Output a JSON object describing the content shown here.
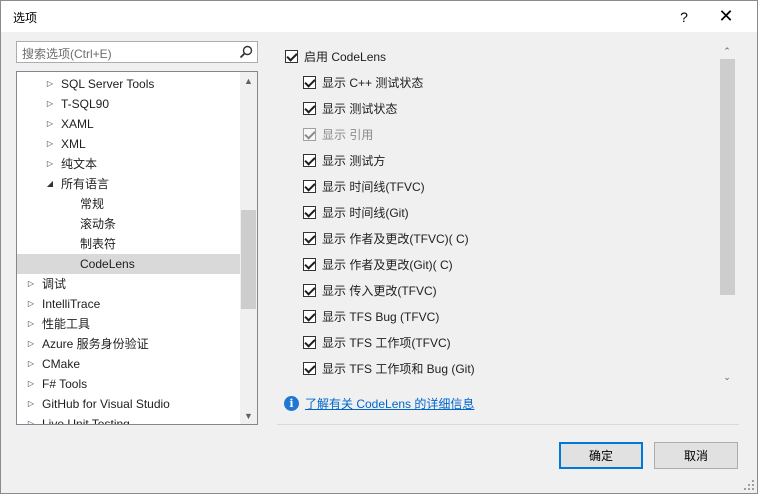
{
  "window": {
    "title": "选项",
    "help_label": "?",
    "close_label": "✕"
  },
  "search": {
    "placeholder": "搜索选项(Ctrl+E)"
  },
  "tree": {
    "items": [
      {
        "label": "SQL Server Tools",
        "arrow": "▷"
      },
      {
        "label": "T-SQL90",
        "arrow": "▷"
      },
      {
        "label": "XAML",
        "arrow": "▷"
      },
      {
        "label": "XML",
        "arrow": "▷"
      },
      {
        "label": "纯文本",
        "arrow": "▷"
      },
      {
        "label": "所有语言",
        "arrow": "◢"
      },
      {
        "label": "常规",
        "arrow": ""
      },
      {
        "label": "滚动条",
        "arrow": ""
      },
      {
        "label": "制表符",
        "arrow": ""
      },
      {
        "label": "CodeLens",
        "arrow": ""
      },
      {
        "label": "调试",
        "arrow": "▷"
      },
      {
        "label": "IntelliTrace",
        "arrow": "▷"
      },
      {
        "label": "性能工具",
        "arrow": "▷"
      },
      {
        "label": "Azure 服务身份验证",
        "arrow": "▷"
      },
      {
        "label": "CMake",
        "arrow": "▷"
      },
      {
        "label": "F# Tools",
        "arrow": "▷"
      },
      {
        "label": "GitHub for Visual Studio",
        "arrow": "▷"
      },
      {
        "label": "Live Unit Testing",
        "arrow": "▷"
      }
    ],
    "selected_label": "CodeLens",
    "scroll_up": "▲",
    "scroll_down": "▼"
  },
  "options": {
    "master": {
      "label": "启用 CodeLens",
      "checked": true
    },
    "items": [
      {
        "label": "显示 C++ 测试状态",
        "checked": true,
        "disabled": false
      },
      {
        "label": "显示 测试状态",
        "checked": true,
        "disabled": false
      },
      {
        "label": "显示 引用",
        "checked": true,
        "disabled": true
      },
      {
        "label": "显示 测试方",
        "checked": true,
        "disabled": false
      },
      {
        "label": "显示 时间线(TFVC)",
        "checked": true,
        "disabled": false
      },
      {
        "label": "显示 时间线(Git)",
        "checked": true,
        "disabled": false
      },
      {
        "label": "显示 作者及更改(TFVC)( C)",
        "checked": true,
        "disabled": false
      },
      {
        "label": "显示 作者及更改(Git)( C)",
        "checked": true,
        "disabled": false
      },
      {
        "label": "显示 传入更改(TFVC)",
        "checked": true,
        "disabled": false
      },
      {
        "label": "显示 TFS Bug (TFVC)",
        "checked": true,
        "disabled": false
      },
      {
        "label": "显示 TFS 工作项(TFVC)",
        "checked": true,
        "disabled": false
      },
      {
        "label": "显示 TFS 工作项和 Bug (Git)",
        "checked": true,
        "disabled": false
      }
    ],
    "scroll_up": "⌃",
    "scroll_down": "⌄"
  },
  "info": {
    "icon_glyph": "i",
    "link_text": "了解有关 CodeLens 的详细信息"
  },
  "buttons": {
    "ok": "确定",
    "cancel": "取消"
  },
  "colors": {
    "accent": "#0078d7",
    "selection": "#cde8ff",
    "link": "#0066cc",
    "info_icon": "#1e77d3"
  }
}
